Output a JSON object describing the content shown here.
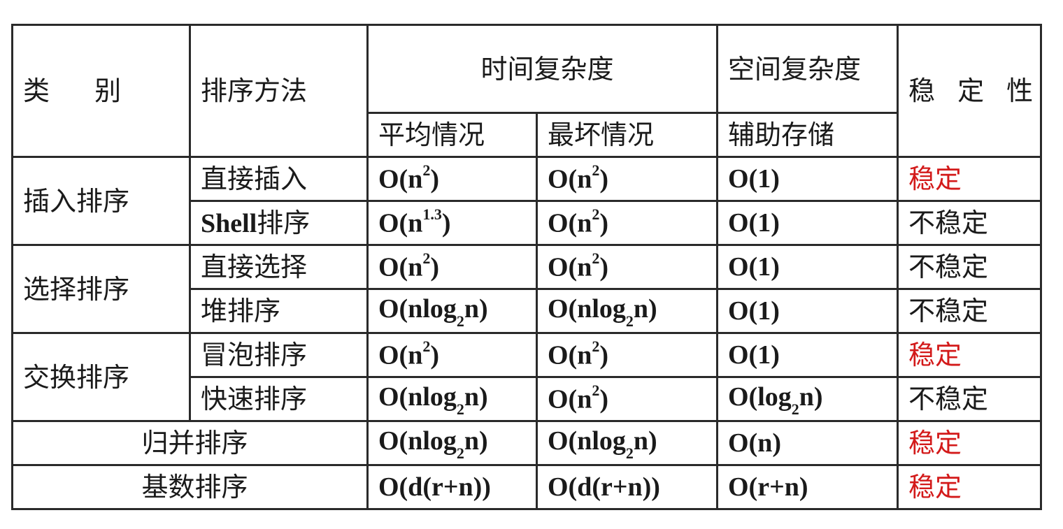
{
  "headers": {
    "category": "类 别",
    "method": "排序方法",
    "time_complexity": "时间复杂度",
    "space_complexity": "空间复杂度",
    "stability": "稳 定 性",
    "average_case": "平均情况",
    "worst_case": "最坏情况",
    "auxiliary_storage": "辅助存储"
  },
  "categories": {
    "insertion": "插入排序",
    "selection": "选择排序",
    "exchange": "交换排序",
    "merge": "归并排序",
    "radix": "基数排序"
  },
  "rows": [
    {
      "method": "直接插入",
      "avg": [
        "O(n",
        "2",
        ")"
      ],
      "worst": [
        "O(n",
        "2",
        ")"
      ],
      "space": "O(1)",
      "stability": "稳定",
      "stable_color": "#d31a1a"
    },
    {
      "method_latin": "Shell",
      "method": "排序",
      "avg": [
        "O(n",
        "1.3",
        ")"
      ],
      "worst": [
        "O(n",
        "2",
        ")"
      ],
      "space": "O(1)",
      "stability": "不稳定"
    },
    {
      "method": "直接选择",
      "avg": [
        "O(n",
        "2",
        ")"
      ],
      "worst": [
        "O(n",
        "2",
        ")"
      ],
      "space": "O(1)",
      "stability": "不稳定"
    },
    {
      "method": "堆排序",
      "avg": [
        "O(nlog",
        "2",
        "n)"
      ],
      "worst": [
        "O(nlog",
        "2",
        "n)"
      ],
      "space": "O(1)",
      "stability": "不稳定"
    },
    {
      "method": "冒泡排序",
      "avg": [
        "O(n",
        "2",
        ")"
      ],
      "worst": [
        "O(n",
        "2",
        ")"
      ],
      "space": "O(1)",
      "stability": "稳定",
      "stable_color": "#d31a1a"
    },
    {
      "method": "快速排序",
      "avg": [
        "O(nlog",
        "2",
        "n)"
      ],
      "worst": [
        "O(n",
        "2",
        ")"
      ],
      "space": [
        "O(log",
        "2",
        "n)"
      ],
      "stability": "不稳定"
    },
    {
      "avg": [
        "O(nlog",
        "2",
        "n)"
      ],
      "worst": [
        "O(nlog",
        "2",
        "n)"
      ],
      "space": "O(n)",
      "stability": "稳定",
      "stable_color": "#d31a1a"
    },
    {
      "avg": "O(d(r+n))",
      "worst": "O(d(r+n))",
      "space": "O(r+n)",
      "stability": "稳定",
      "stable_color": "#d31a1a"
    }
  ]
}
